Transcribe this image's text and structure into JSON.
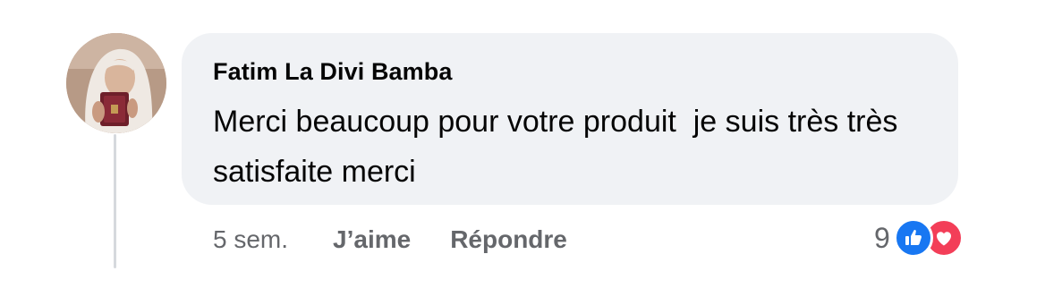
{
  "comment": {
    "author": "Fatim La Divi Bamba",
    "text": "Merci beaucoup pour votre produit  je suis très très satisfaite merci"
  },
  "actions": {
    "timestamp": "5 sem.",
    "like_label": "J’aime",
    "reply_label": "Répondre"
  },
  "reactions": {
    "count": "9",
    "icons": [
      "like-icon",
      "love-icon"
    ],
    "colors": {
      "like": "#1877f2",
      "love": "#f33e58"
    }
  },
  "theme": {
    "bubble_bg": "#f0f2f5",
    "text": "#050505",
    "secondary_text": "#65676b"
  }
}
